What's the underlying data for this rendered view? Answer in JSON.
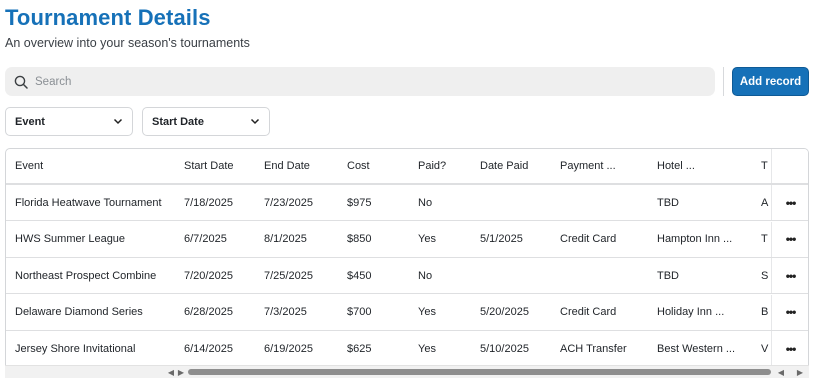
{
  "header": {
    "title": "Tournament Details",
    "subtitle": "An overview into your season's tournaments"
  },
  "search": {
    "placeholder": "Search",
    "icon": "search-icon"
  },
  "toolbar": {
    "add_label": "Add record",
    "accent_color": "#1671b8"
  },
  "filters": [
    {
      "label": "Event"
    },
    {
      "label": "Start Date"
    }
  ],
  "table": {
    "columns": [
      "Event",
      "Start Date",
      "End Date",
      "Cost",
      "Paid?",
      "Date Paid",
      "Payment ...",
      "Hotel ...",
      "T"
    ],
    "more_label": "•••",
    "rows": [
      [
        "Florida Heatwave Tournament",
        "7/18/2025",
        "7/23/2025",
        "$975",
        "No",
        "",
        "",
        "TBD",
        "A"
      ],
      [
        "HWS Summer League",
        "6/7/2025",
        "8/1/2025",
        "$850",
        "Yes",
        "5/1/2025",
        "Credit Card",
        "Hampton Inn ...",
        "T"
      ],
      [
        "Northeast Prospect Combine",
        "7/20/2025",
        "7/25/2025",
        "$450",
        "No",
        "",
        "",
        "TBD",
        "S"
      ],
      [
        "Delaware Diamond Series",
        "6/28/2025",
        "7/3/2025",
        "$700",
        "Yes",
        "5/20/2025",
        "Credit Card",
        "Holiday Inn ...",
        "B"
      ],
      [
        "Jersey Shore Invitational",
        "6/14/2025",
        "6/19/2025",
        "$625",
        "Yes",
        "5/10/2025",
        "ACH Transfer",
        "Best Western ...",
        "V"
      ]
    ]
  },
  "scrollbar": {
    "left_arrow": "◀",
    "right_arrow": "▶"
  }
}
